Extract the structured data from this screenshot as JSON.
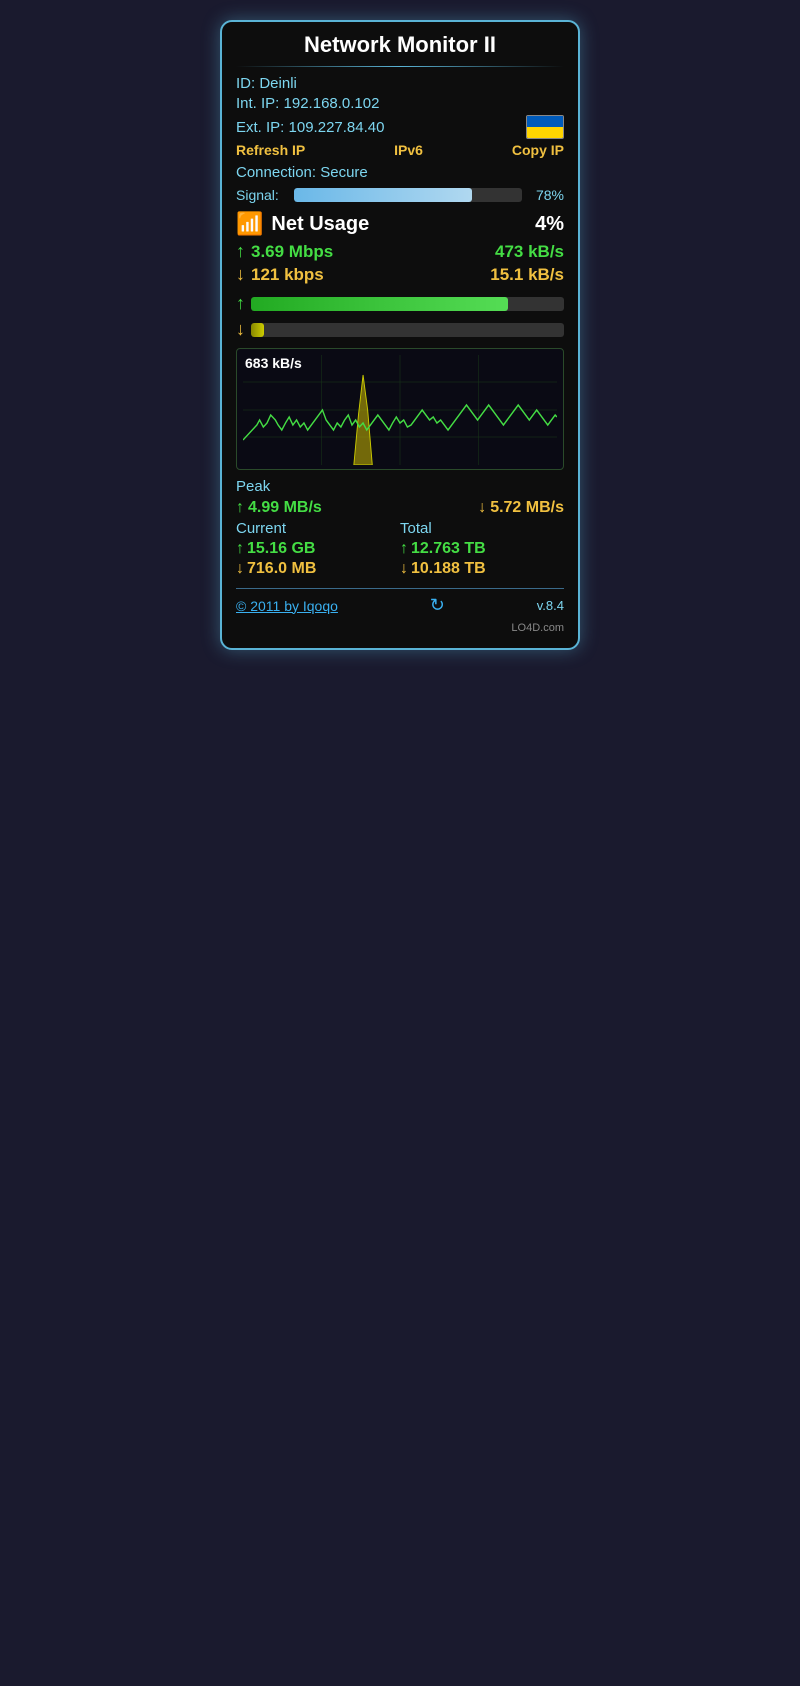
{
  "widget": {
    "title": "Network Monitor II",
    "id_label": "ID:",
    "id_value": "Deinli",
    "int_ip_label": "Int. IP:",
    "int_ip_value": "192.168.0.102",
    "ext_ip_label": "Ext. IP:",
    "ext_ip_value": "109.227.84.40",
    "refresh_btn": "Refresh IP",
    "ipv6_btn": "IPv6",
    "copy_ip_btn": "Copy IP",
    "connection_label": "Connection:",
    "connection_value": "Secure",
    "signal_label": "Signal:",
    "signal_pct": "78%",
    "signal_value": 78,
    "net_usage_label": "Net Usage",
    "net_usage_pct": "4%",
    "upload_mbps": "3.69 Mbps",
    "upload_kbs": "473 kB/s",
    "download_kbps": "121 kbps",
    "download_kbs": "15.1 kB/s",
    "upload_progress": 82,
    "download_progress": 4,
    "chart_label": "683 kB/s",
    "peak_title": "Peak",
    "peak_upload": "4.99 MB/s",
    "peak_download": "5.72 MB/s",
    "current_label": "Current",
    "total_label": "Total",
    "current_upload": "15.16 GB",
    "current_download": "716.0 MB",
    "total_upload": "12.763 TB",
    "total_download": "10.188 TB",
    "footer_link": "© 2011 by Iqoqo",
    "footer_version": "v.8.4",
    "watermark": "LO4D.com"
  }
}
